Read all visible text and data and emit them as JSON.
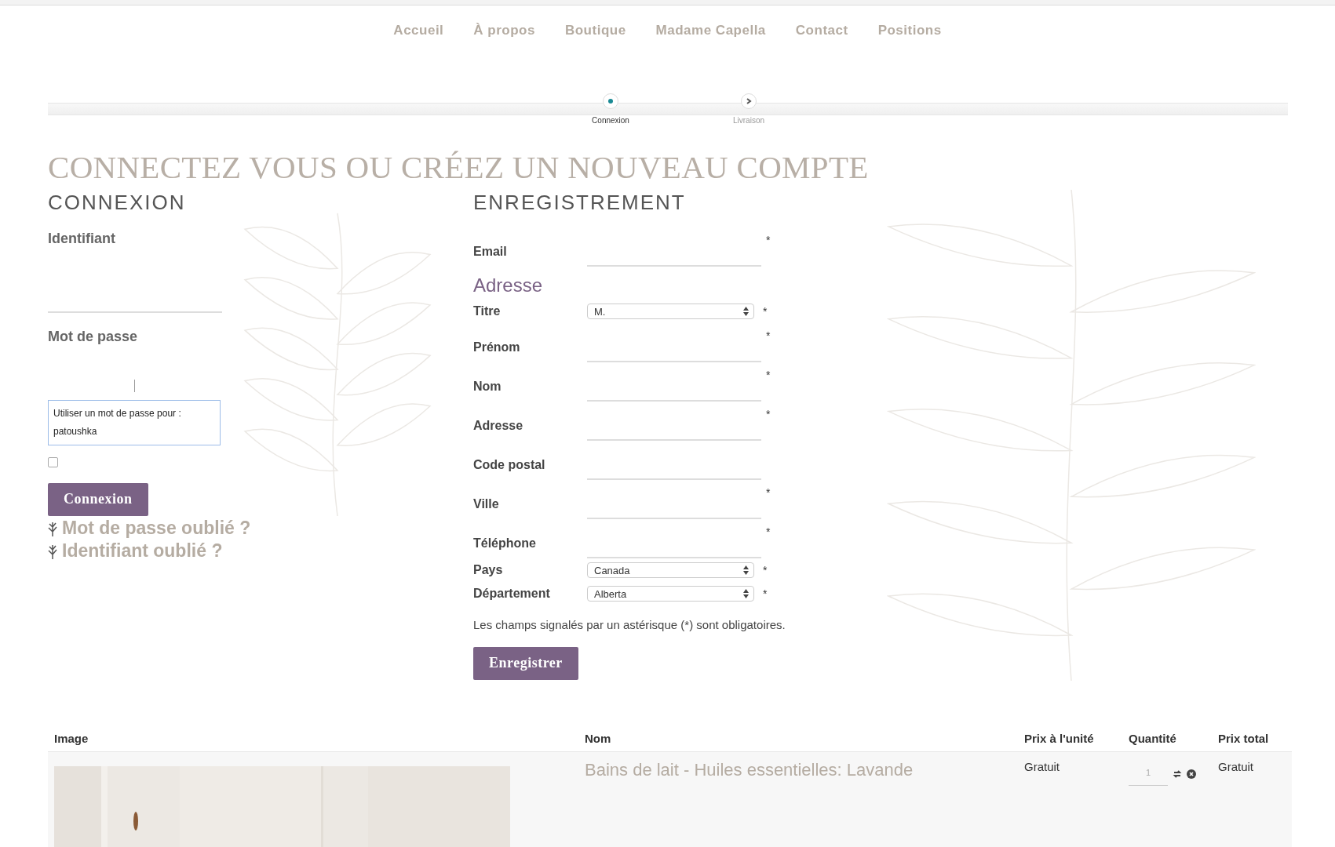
{
  "nav": [
    {
      "label": "Accueil"
    },
    {
      "label": "À propos"
    },
    {
      "label": "Boutique"
    },
    {
      "label": "Madame Capella"
    },
    {
      "label": "Contact"
    },
    {
      "label": "Positions"
    }
  ],
  "steps": [
    {
      "label": "Connexion",
      "selected": true
    },
    {
      "label": "Livraison",
      "selected": false
    }
  ],
  "page_title": "CONNECTEZ VOUS OU CRÉEZ UN NOUVEAU COMPTE",
  "login": {
    "heading": "CONNEXION",
    "fields": [
      {
        "label": "Identifiant",
        "kind": "text"
      },
      {
        "label": "Mot de passe",
        "kind": "password"
      }
    ],
    "autocomplete": {
      "text": "Utiliser un mot de passe pour :",
      "account": "patoushka"
    },
    "remember": {
      "checked": false
    },
    "button": "Connexion",
    "links": [
      "Mot de passe oublié ?",
      "Identifiant oublié ?"
    ]
  },
  "register": {
    "heading": "ENREGISTREMENT",
    "fields": [
      {
        "kind": "text",
        "label": "Email",
        "required_mark": "*"
      },
      {
        "kind": "section",
        "label": "Adresse"
      },
      {
        "kind": "select",
        "label": "Titre",
        "value": "M.",
        "required_mark": "*"
      },
      {
        "kind": "text",
        "label": "Prénom",
        "required_mark": "*"
      },
      {
        "kind": "text",
        "label": "Nom",
        "required_mark": "*"
      },
      {
        "kind": "text",
        "label": "Adresse",
        "required_mark": "*"
      },
      {
        "kind": "text",
        "label": "Code postal"
      },
      {
        "kind": "text",
        "label": "Ville",
        "required_mark": "*"
      },
      {
        "kind": "text",
        "label": "Téléphone",
        "required_mark": "*"
      },
      {
        "kind": "select",
        "label": "Pays",
        "value": "Canada",
        "required_mark": "*"
      },
      {
        "kind": "select",
        "label": "Département",
        "value": "Alberta",
        "required_mark": "*"
      }
    ],
    "note": "Les champs signalés par un astérisque (*) sont obligatoires.",
    "button": "Enregistrer"
  },
  "cart": {
    "columns": [
      "Image",
      "Nom",
      "Prix à l'unité",
      "Quantité",
      "Prix total"
    ],
    "rows": [
      {
        "name": "Bains de lait - Huiles essentielles: Lavande",
        "unit_price": "Gratuit",
        "quantity": "1",
        "total": "Gratuit"
      }
    ]
  }
}
